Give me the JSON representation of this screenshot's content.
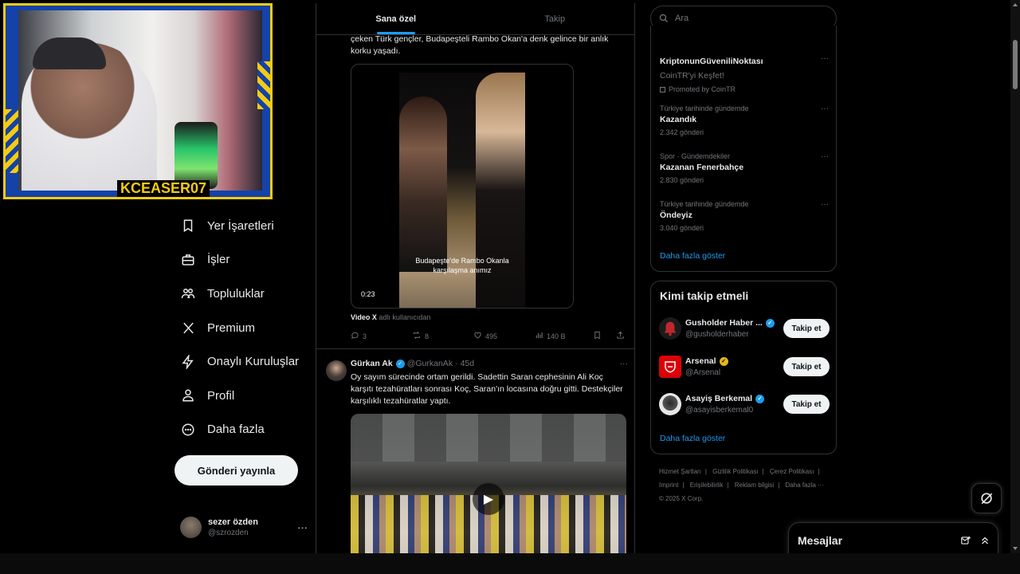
{
  "webcam": {
    "logo_text": "KCEASER07"
  },
  "nav": {
    "items": [
      {
        "label": "Yer İşaretleri",
        "icon": "bookmark-icon"
      },
      {
        "label": "İşler",
        "icon": "briefcase-icon"
      },
      {
        "label": "Topluluklar",
        "icon": "people-icon"
      },
      {
        "label": "Premium",
        "icon": "x-logo-icon"
      },
      {
        "label": "Onaylı Kuruluşlar",
        "icon": "lightning-icon"
      },
      {
        "label": "Profil",
        "icon": "person-icon"
      },
      {
        "label": "Daha fazla",
        "icon": "more-circle-icon"
      }
    ],
    "post_button": "Gönderi yayınla",
    "user": {
      "name": "sezer özden",
      "handle": "@szrozden",
      "more": "···"
    }
  },
  "feed": {
    "tabs": [
      {
        "label": "Sana özel",
        "active": true
      },
      {
        "label": "Takip",
        "active": false
      }
    ],
    "tweet1": {
      "text": "çeken Türk gençler, Budapeşteli Rambo Okan'a denk gelince bir anlık korku yaşadı.",
      "video_caption": "Budapeşte'de Rambo Okanla karşılaşma anımız",
      "video_duration": "0:23",
      "source_prefix": "Video X",
      "source_suffix": "adlı kullanıcıdan",
      "replies": "3",
      "reposts": "8",
      "likes": "495",
      "views": "140 B"
    },
    "tweet2": {
      "name": "Gürkan Ak",
      "handle": "@GurkanAk",
      "time": "45d",
      "separator": "·",
      "more": "···",
      "text": "Oy sayım sürecinde ortam gerildi. Sadettin Saran cephesinin Ali Koç karşıtı tezahüratları sonrası Koç, Saran'ın locasına doğru gitti. Destekçiler karşılıklı tezahüratlar yaptı."
    }
  },
  "right": {
    "search_placeholder": "Ara",
    "trends": [
      {
        "context": "",
        "title": "KriptonunGüveniliNoktası",
        "subtitle": "CoinTR'yi Keşfet!",
        "promo": "Promoted by CoinTR",
        "count": ""
      },
      {
        "context": "Türkiye tarihinde gündemde",
        "title": "Kazandık",
        "count": "2.342 gönderi"
      },
      {
        "context": "Spor · Gündemdekiler",
        "title": "Kazanan Fenerbahçe",
        "count": "2.830 gönderi"
      },
      {
        "context": "Türkiye tarihinde gündemde",
        "title": "Öndeyiz",
        "count": "3.040 gönderi"
      }
    ],
    "trends_more": "Daha fazla göster",
    "trend_dots": "···",
    "who_to_follow": {
      "title": "Kimi takip etmeli",
      "accounts": [
        {
          "name": "Gusholder Haber ...",
          "handle": "@gusholderhaber",
          "badge": "blue",
          "avatar_color": "#c0282d"
        },
        {
          "name": "Arsenal",
          "handle": "@Arsenal",
          "badge": "gold",
          "avatar_color": "#db0007"
        },
        {
          "name": "Asayiş Berkemal",
          "handle": "@asayisberkemal0",
          "badge": "blue",
          "avatar_color": "#e6e6e6"
        }
      ],
      "follow_label": "Takip et",
      "more": "Daha fazla göster"
    },
    "footer": {
      "links": [
        "Hizmet Şartları",
        "Gizlilik Politikası",
        "Çerez Politikası",
        "Imprint",
        "Erişilebilirlik",
        "Reklam bilgisi",
        "Daha fazla ···"
      ],
      "copyright": "© 2025 X Corp."
    }
  },
  "messages": {
    "title": "Mesajlar"
  },
  "colors": {
    "accent": "#1d9bf0",
    "background": "#000000",
    "border": "#2f3336",
    "muted": "#71767b"
  }
}
